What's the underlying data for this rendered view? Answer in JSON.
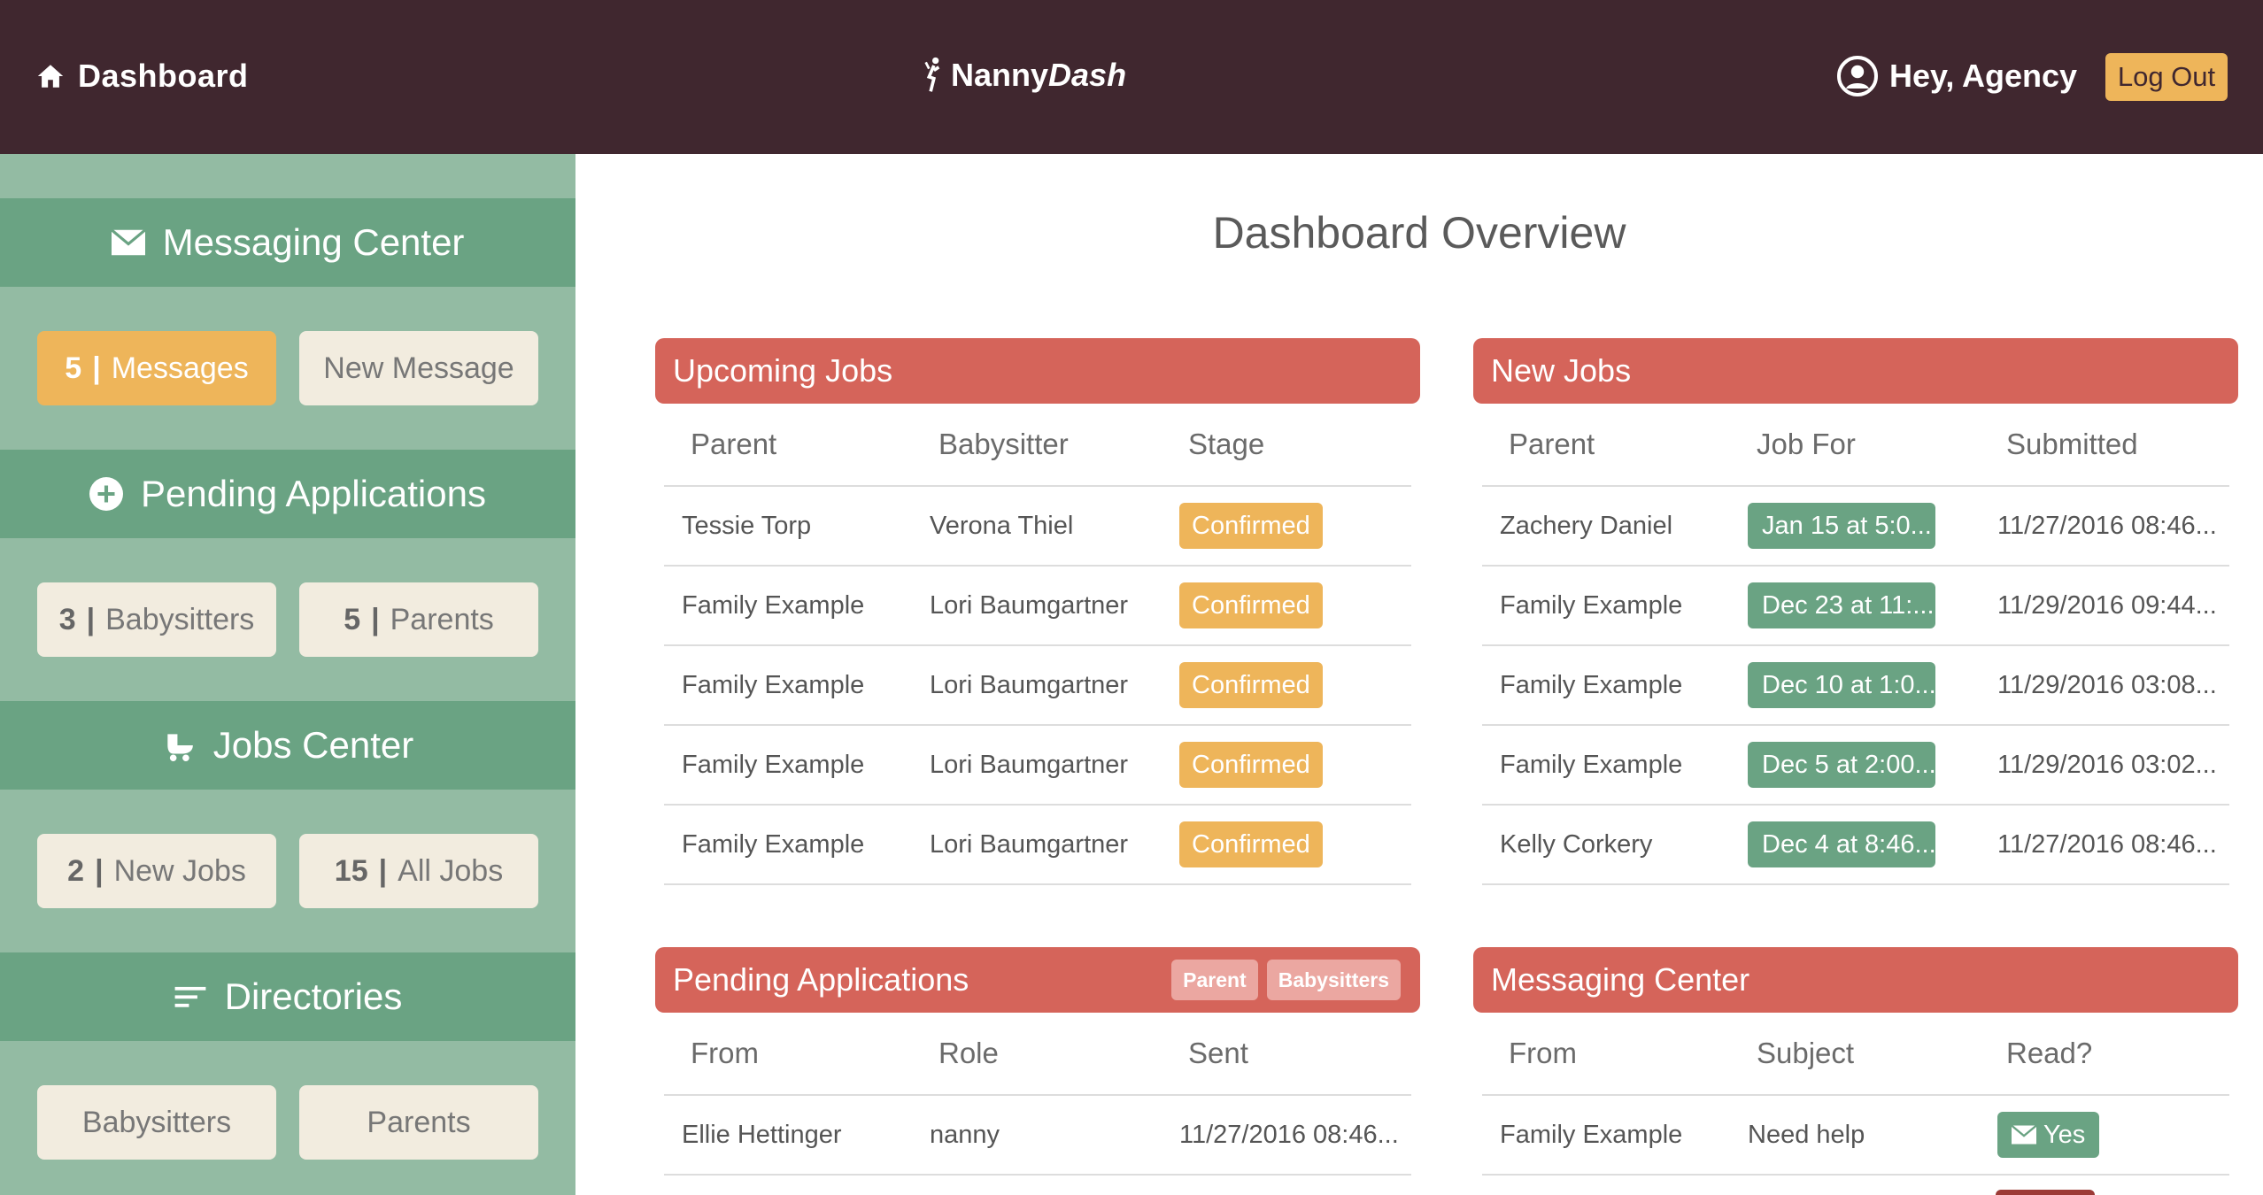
{
  "header": {
    "dashboard_label": "Dashboard",
    "logo_main": "Nanny",
    "logo_italic": "Dash",
    "greeting": "Hey, Agency",
    "logout_label": "Log Out"
  },
  "sidebar": {
    "messaging": {
      "title": "Messaging Center",
      "messages_count": "5",
      "messages_label": "Messages",
      "new_message_label": "New Message"
    },
    "pending": {
      "title": "Pending Applications",
      "babysitters_count": "3",
      "babysitters_label": "Babysitters",
      "parents_count": "5",
      "parents_label": "Parents"
    },
    "jobs": {
      "title": "Jobs Center",
      "new_count": "2",
      "new_label": "New Jobs",
      "all_count": "15",
      "all_label": "All Jobs"
    },
    "directories": {
      "title": "Directories",
      "babysitters_label": "Babysitters",
      "parents_label": "Parents"
    },
    "separator": "|"
  },
  "main": {
    "title": "Dashboard Overview"
  },
  "upcoming_jobs": {
    "title": "Upcoming Jobs",
    "headers": [
      "Parent",
      "Babysitter",
      "Stage"
    ],
    "rows": [
      {
        "parent": "Tessie Torp",
        "babysitter": "Verona Thiel",
        "stage": "Confirmed"
      },
      {
        "parent": "Family Example",
        "babysitter": "Lori Baumgartner",
        "stage": "Confirmed"
      },
      {
        "parent": "Family Example",
        "babysitter": "Lori Baumgartner",
        "stage": "Confirmed"
      },
      {
        "parent": "Family Example",
        "babysitter": "Lori Baumgartner",
        "stage": "Confirmed"
      },
      {
        "parent": "Family Example",
        "babysitter": "Lori Baumgartner",
        "stage": "Confirmed"
      }
    ]
  },
  "new_jobs": {
    "title": "New Jobs",
    "headers": [
      "Parent",
      "Job For",
      "Submitted"
    ],
    "rows": [
      {
        "parent": "Zachery Daniel",
        "job_for": "Jan 15 at 5:0...",
        "submitted": "11/27/2016 08:46..."
      },
      {
        "parent": "Family Example",
        "job_for": "Dec 23 at 11:...",
        "submitted": "11/29/2016 09:44..."
      },
      {
        "parent": "Family Example",
        "job_for": "Dec 10 at 1:0...",
        "submitted": "11/29/2016 03:08..."
      },
      {
        "parent": "Family Example",
        "job_for": "Dec 5 at 2:00...",
        "submitted": "11/29/2016 03:02..."
      },
      {
        "parent": "Kelly Corkery",
        "job_for": "Dec 4 at 8:46...",
        "submitted": "11/27/2016 08:46..."
      }
    ]
  },
  "pending_applications": {
    "title": "Pending Applications",
    "tag_parent": "Parent",
    "tag_babysitters": "Babysitters",
    "headers": [
      "From",
      "Role",
      "Sent"
    ],
    "rows": [
      {
        "from": "Ellie Hettinger",
        "role": "nanny",
        "sent": "11/27/2016 08:46..."
      }
    ]
  },
  "messaging_center": {
    "title": "Messaging Center",
    "headers": [
      "From",
      "Subject",
      "Read?"
    ],
    "rows": [
      {
        "from": "Family Example",
        "subject": "Need help",
        "read": "Yes"
      }
    ]
  },
  "colors": {
    "topbar": "#40272f",
    "sidebar": "#93bba3",
    "sidebar_head": "#6aa383",
    "panel_head": "#d5645a",
    "accent_yellow": "#eeb55a",
    "accent_green": "#6aa383"
  },
  "icons": [
    "home-icon",
    "stroller-icon",
    "user-circle-icon",
    "envelope-icon",
    "plus-circle-icon",
    "stroller-icon",
    "list-icon"
  ]
}
